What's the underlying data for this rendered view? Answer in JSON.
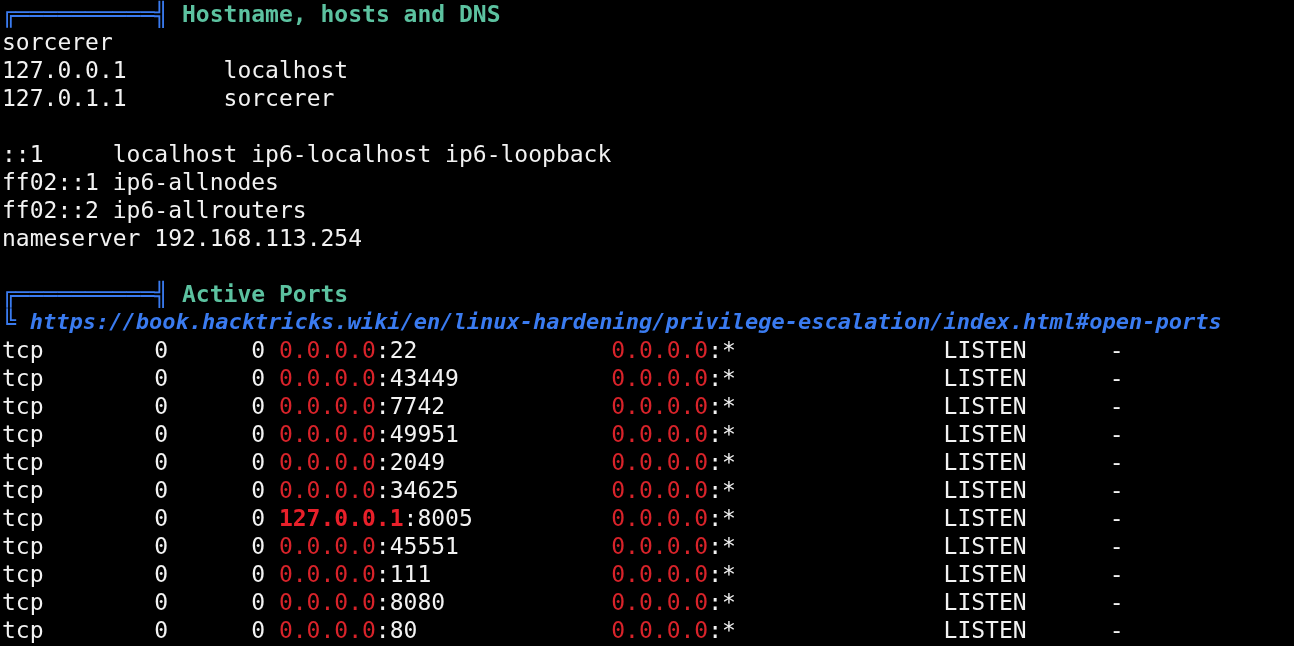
{
  "sections": [
    {
      "banner": "╔══════════╣",
      "title": "Hostname, hosts and DNS",
      "blocks": [
        [
          "sorcerer",
          "127.0.0.1       localhost",
          "127.0.1.1       sorcerer"
        ],
        [
          "::1     localhost ip6-localhost ip6-loopback",
          "ff02::1 ip6-allnodes",
          "ff02::2 ip6-allrouters",
          "nameserver 192.168.113.254"
        ]
      ]
    },
    {
      "banner": "╔══════════╣",
      "title": "Active Ports",
      "corner": "╚",
      "url": "https://book.hacktricks.wiki/en/linux-hardening/privilege-escalation/index.html#open-ports",
      "ports": [
        {
          "proto": "tcp",
          "recv": "0",
          "send": "0",
          "local_ip": "0.0.0.0",
          "local_port": ":22",
          "foreign_ip": "0.0.0.0",
          "foreign_port": ":*",
          "state": "LISTEN",
          "program": "-",
          "loopback": false
        },
        {
          "proto": "tcp",
          "recv": "0",
          "send": "0",
          "local_ip": "0.0.0.0",
          "local_port": ":43449",
          "foreign_ip": "0.0.0.0",
          "foreign_port": ":*",
          "state": "LISTEN",
          "program": "-",
          "loopback": false
        },
        {
          "proto": "tcp",
          "recv": "0",
          "send": "0",
          "local_ip": "0.0.0.0",
          "local_port": ":7742",
          "foreign_ip": "0.0.0.0",
          "foreign_port": ":*",
          "state": "LISTEN",
          "program": "-",
          "loopback": false
        },
        {
          "proto": "tcp",
          "recv": "0",
          "send": "0",
          "local_ip": "0.0.0.0",
          "local_port": ":49951",
          "foreign_ip": "0.0.0.0",
          "foreign_port": ":*",
          "state": "LISTEN",
          "program": "-",
          "loopback": false
        },
        {
          "proto": "tcp",
          "recv": "0",
          "send": "0",
          "local_ip": "0.0.0.0",
          "local_port": ":2049",
          "foreign_ip": "0.0.0.0",
          "foreign_port": ":*",
          "state": "LISTEN",
          "program": "-",
          "loopback": false
        },
        {
          "proto": "tcp",
          "recv": "0",
          "send": "0",
          "local_ip": "0.0.0.0",
          "local_port": ":34625",
          "foreign_ip": "0.0.0.0",
          "foreign_port": ":*",
          "state": "LISTEN",
          "program": "-",
          "loopback": false
        },
        {
          "proto": "tcp",
          "recv": "0",
          "send": "0",
          "local_ip": "127.0.0.1",
          "local_port": ":8005",
          "foreign_ip": "0.0.0.0",
          "foreign_port": ":*",
          "state": "LISTEN",
          "program": "-",
          "loopback": true
        },
        {
          "proto": "tcp",
          "recv": "0",
          "send": "0",
          "local_ip": "0.0.0.0",
          "local_port": ":45551",
          "foreign_ip": "0.0.0.0",
          "foreign_port": ":*",
          "state": "LISTEN",
          "program": "-",
          "loopback": false
        },
        {
          "proto": "tcp",
          "recv": "0",
          "send": "0",
          "local_ip": "0.0.0.0",
          "local_port": ":111",
          "foreign_ip": "0.0.0.0",
          "foreign_port": ":*",
          "state": "LISTEN",
          "program": "-",
          "loopback": false
        },
        {
          "proto": "tcp",
          "recv": "0",
          "send": "0",
          "local_ip": "0.0.0.0",
          "local_port": ":8080",
          "foreign_ip": "0.0.0.0",
          "foreign_port": ":*",
          "state": "LISTEN",
          "program": "-",
          "loopback": false
        },
        {
          "proto": "tcp",
          "recv": "0",
          "send": "0",
          "local_ip": "0.0.0.0",
          "local_port": ":80",
          "foreign_ip": "0.0.0.0",
          "foreign_port": ":*",
          "state": "LISTEN",
          "program": "-",
          "loopback": false
        }
      ]
    }
  ]
}
